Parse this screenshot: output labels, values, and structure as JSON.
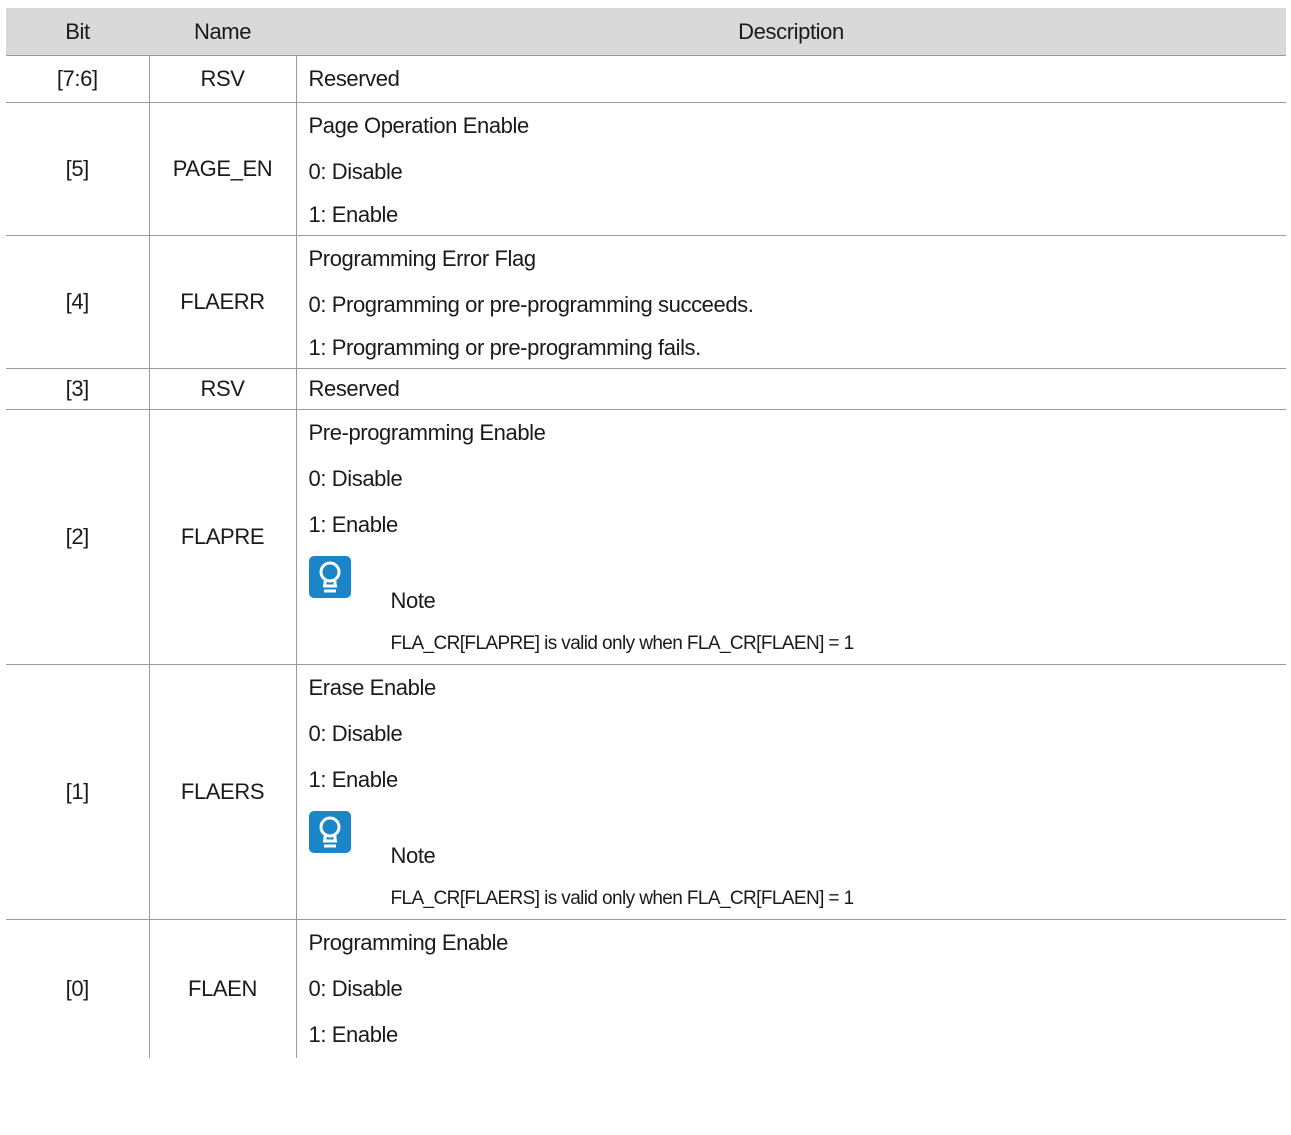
{
  "headers": {
    "bit": "Bit",
    "name": "Name",
    "description": "Description"
  },
  "rows": [
    {
      "bit": "[7:6]",
      "name": "RSV",
      "desc_lines": [
        "Reserved"
      ]
    },
    {
      "bit": "[5]",
      "name": "PAGE_EN",
      "desc_lines": [
        "Page Operation Enable",
        "0: Disable",
        "1: Enable"
      ]
    },
    {
      "bit": "[4]",
      "name": "FLAERR",
      "desc_lines": [
        "Programming Error Flag",
        "0: Programming or pre-programming succeeds.",
        "1: Programming or pre-programming fails."
      ]
    },
    {
      "bit": "[3]",
      "name": "RSV",
      "desc_lines": [
        "Reserved"
      ]
    },
    {
      "bit": "[2]",
      "name": "FLAPRE",
      "desc_lines": [
        "Pre-programming Enable",
        "0: Disable",
        "1: Enable"
      ],
      "note": {
        "icon": "lightbulb-icon",
        "title": "Note",
        "text": "FLA_CR[FLAPRE] is valid only when FLA_CR[FLAEN] = 1"
      }
    },
    {
      "bit": "[1]",
      "name": "FLAERS",
      "desc_lines": [
        "Erase Enable",
        "0: Disable",
        "1: Enable"
      ],
      "note": {
        "icon": "lightbulb-icon",
        "title": "Note",
        "text": "FLA_CR[FLAERS] is valid only when FLA_CR[FLAEN] = 1"
      }
    },
    {
      "bit": "[0]",
      "name": "FLAEN",
      "desc_lines": [
        "Programming Enable",
        "0: Disable",
        "1: Enable"
      ]
    }
  ],
  "colors": {
    "header_bg": "#d9d9d9",
    "note_icon_bg": "#1a86c7",
    "border": "#9a9a9a"
  }
}
